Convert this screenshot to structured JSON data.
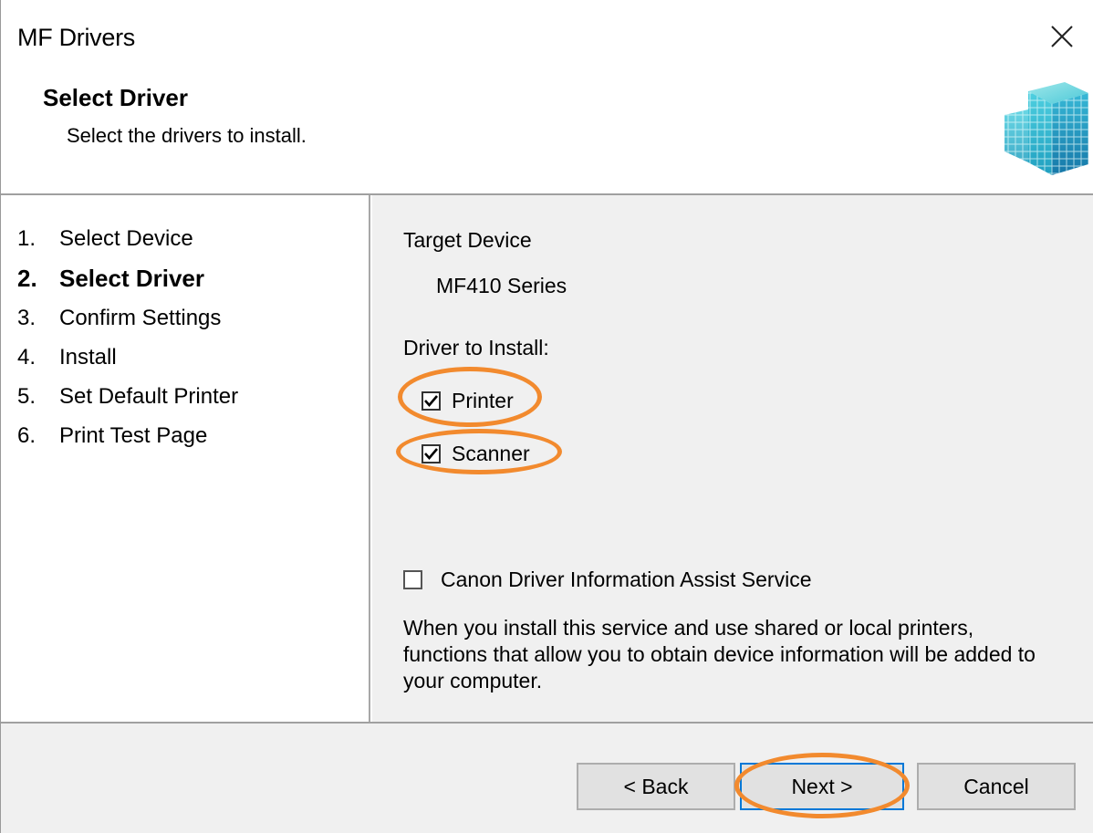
{
  "window": {
    "title": "MF Drivers"
  },
  "header": {
    "title": "Select Driver",
    "subtitle": "Select the drivers to install.",
    "logo_icon": "cube-blocks-icon"
  },
  "steps": [
    {
      "num": "1.",
      "label": "Select Device",
      "active": false
    },
    {
      "num": "2.",
      "label": "Select Driver",
      "active": true
    },
    {
      "num": "3.",
      "label": "Confirm Settings",
      "active": false
    },
    {
      "num": "4.",
      "label": "Install",
      "active": false
    },
    {
      "num": "5.",
      "label": "Set Default Printer",
      "active": false
    },
    {
      "num": "6.",
      "label": "Print Test Page",
      "active": false
    }
  ],
  "main": {
    "target_device_label": "Target Device",
    "target_device_value": "MF410 Series",
    "driver_to_install_label": "Driver to Install:",
    "drivers": [
      {
        "label": "Printer",
        "checked": true
      },
      {
        "label": "Scanner",
        "checked": true
      }
    ],
    "assist_service": {
      "label": "Canon Driver Information Assist Service",
      "checked": false,
      "description": "When you install this service and use shared or local printers, functions that allow you to obtain device information will be added to your computer."
    }
  },
  "buttons": {
    "back": "< Back",
    "next": "Next >",
    "cancel": "Cancel"
  },
  "colors": {
    "highlight": "#f28a2e",
    "pane_background": "#f0f0f0",
    "default_button_border": "#0078d7"
  }
}
